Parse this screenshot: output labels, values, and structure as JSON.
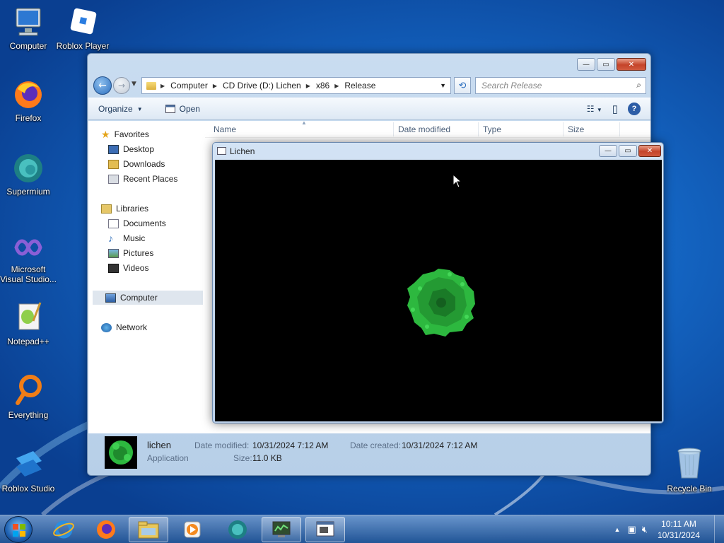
{
  "desktop": {
    "icons": [
      {
        "label": "Computer",
        "icon": "computer-icon"
      },
      {
        "label": "Roblox Player",
        "icon": "roblox-player-icon"
      },
      {
        "label": "Firefox",
        "icon": "firefox-icon"
      },
      {
        "label": "Supermium",
        "icon": "supermium-icon"
      },
      {
        "label": "Microsoft Visual Studio...",
        "icon": "visual-studio-icon"
      },
      {
        "label": "Notepad++",
        "icon": "notepadpp-icon"
      },
      {
        "label": "Everything",
        "icon": "everything-icon"
      },
      {
        "label": "Roblox Studio",
        "icon": "roblox-studio-icon"
      },
      {
        "label": "Recycle Bin",
        "icon": "recycle-bin-icon"
      }
    ]
  },
  "explorer": {
    "breadcrumb": [
      "Computer",
      "CD Drive (D:) Lichen",
      "x86",
      "Release"
    ],
    "search_placeholder": "Search Release",
    "toolbar": {
      "organize": "Organize",
      "open": "Open"
    },
    "nav": {
      "favorites": "Favorites",
      "desktop": "Desktop",
      "downloads": "Downloads",
      "recent": "Recent Places",
      "libraries": "Libraries",
      "documents": "Documents",
      "music": "Music",
      "pictures": "Pictures",
      "videos": "Videos",
      "computer": "Computer",
      "network": "Network"
    },
    "columns": {
      "name": "Name",
      "date": "Date modified",
      "type": "Type",
      "size": "Size"
    },
    "details": {
      "name": "lichen",
      "kind": "Application",
      "date_modified_label": "Date modified:",
      "date_modified": "10/31/2024 7:12 AM",
      "date_created_label": "Date created:",
      "date_created": "10/31/2024 7:12 AM",
      "size_label": "Size:",
      "size": "11.0 KB"
    }
  },
  "lichen_window": {
    "title": "Lichen"
  },
  "taskbar": {
    "time": "10:11 AM",
    "date": "10/31/2024"
  },
  "colors": {
    "lichen_green": "#2db83f",
    "canvas": "#000000"
  }
}
